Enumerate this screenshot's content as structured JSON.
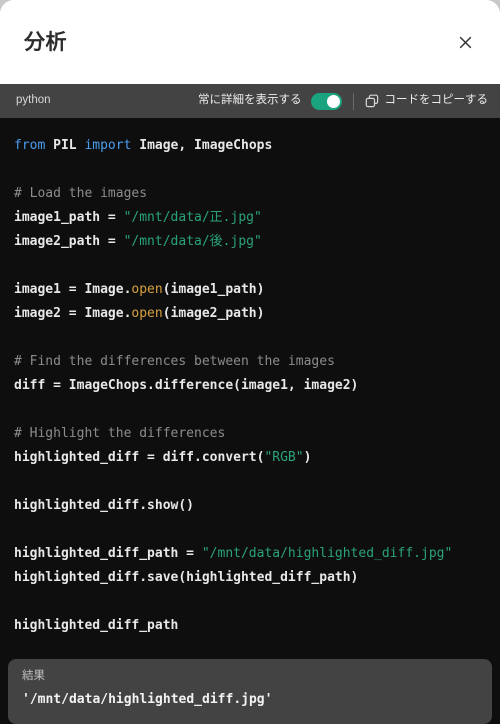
{
  "header": {
    "title": "分析",
    "close_icon": "close-icon"
  },
  "toolbar": {
    "language": "python",
    "detail_toggle_label": "常に詳細を表示する",
    "detail_toggle_state": "on",
    "copy_icon": "copy-icon",
    "copy_label": "コードをコピーする",
    "toggle_color": "#19a37e",
    "background": "#434343"
  },
  "code": {
    "background": "#0e0e0e",
    "colors": {
      "keyword": "#4a9df0",
      "string": "#29a37a",
      "comment": "#8c8c8c",
      "builtin": "#d8a13f",
      "plain": "#e8e8e8"
    },
    "lines": [
      [
        {
          "t": "from ",
          "c": "kw"
        },
        {
          "t": "PIL ",
          "c": "plain"
        },
        {
          "t": "import ",
          "c": "kw"
        },
        {
          "t": "Image, ImageChops",
          "c": "plain"
        }
      ],
      [],
      [
        {
          "t": "# Load the images",
          "c": "com"
        }
      ],
      [
        {
          "t": "image1_path = ",
          "c": "plain"
        },
        {
          "t": "\"/mnt/data/正.jpg\"",
          "c": "str"
        }
      ],
      [
        {
          "t": "image2_path = ",
          "c": "plain"
        },
        {
          "t": "\"/mnt/data/後.jpg\"",
          "c": "str"
        }
      ],
      [],
      [
        {
          "t": "image1 = Image.",
          "c": "plain"
        },
        {
          "t": "open",
          "c": "builtin"
        },
        {
          "t": "(image1_path)",
          "c": "plain"
        }
      ],
      [
        {
          "t": "image2 = Image.",
          "c": "plain"
        },
        {
          "t": "open",
          "c": "builtin"
        },
        {
          "t": "(image2_path)",
          "c": "plain"
        }
      ],
      [],
      [
        {
          "t": "# Find the differences between the images",
          "c": "com"
        }
      ],
      [
        {
          "t": "diff = ImageChops.difference(image1, image2)",
          "c": "plain"
        }
      ],
      [],
      [
        {
          "t": "# Highlight the differences",
          "c": "com"
        }
      ],
      [
        {
          "t": "highlighted_diff = diff.convert(",
          "c": "plain"
        },
        {
          "t": "\"RGB\"",
          "c": "str"
        },
        {
          "t": ")",
          "c": "plain"
        }
      ],
      [],
      [
        {
          "t": "highlighted_diff.show()",
          "c": "plain"
        }
      ],
      [],
      [
        {
          "t": "highlighted_diff_path = ",
          "c": "plain"
        },
        {
          "t": "\"/mnt/data/highlighted_diff.jpg\"",
          "c": "str"
        }
      ],
      [
        {
          "t": "highlighted_diff.save(highlighted_diff_path)",
          "c": "plain"
        }
      ],
      [],
      [
        {
          "t": "highlighted_diff_path",
          "c": "plain"
        }
      ]
    ]
  },
  "result": {
    "label": "結果",
    "value": "'/mnt/data/highlighted_diff.jpg'",
    "background": "#434343"
  }
}
